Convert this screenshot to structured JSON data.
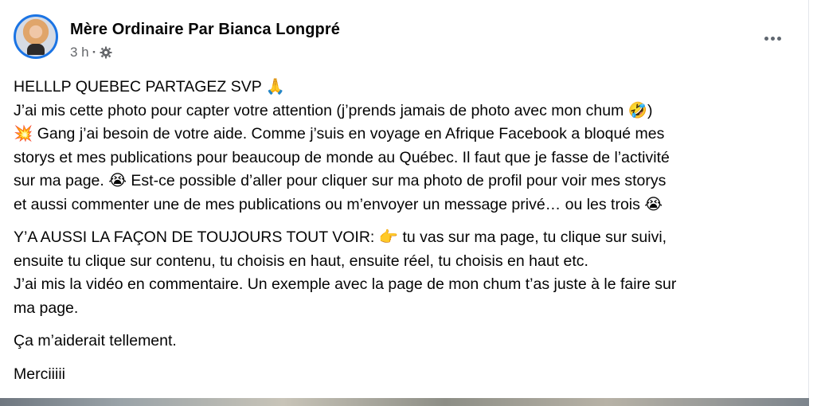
{
  "post": {
    "author": "Mère Ordinaire Par Bianca Longpré",
    "time": "3 h",
    "separator": "·",
    "icons": {
      "privacy": "gear-icon",
      "more": "more-options-icon"
    },
    "paragraphs": [
      {
        "lines": [
          "HELLLP QUEBEC PARTAGEZ SVP 🙏",
          "J’ai mis cette photo pour capter votre attention (j’prends jamais de photo avec mon chum 🤣)",
          "💥 Gang j’ai besoin de votre aide. Comme j’suis en voyage en Afrique Facebook a bloqué mes",
          "storys et mes publications pour beaucoup de monde au Québec. Il faut que je fasse de l’activité",
          "sur ma page. 😭 Est-ce possible d’aller pour cliquer sur ma photo de profil pour voir mes storys",
          "et aussi commenter une de mes publications ou m’envoyer un message privé… ou les trois 😭"
        ]
      },
      {
        "lines": [
          "Y’A AUSSI LA FAÇON DE TOUJOURS TOUT VOIR: 👉 tu vas sur ma page, tu clique sur suivi,",
          "ensuite tu clique sur contenu, tu choisis en haut, ensuite réel, tu choisis en haut etc.",
          "J’ai mis la vidéo en commentaire. Un exemple avec la page de mon chum t’as juste à le faire sur",
          "ma page."
        ]
      },
      {
        "lines": [
          "Ça m’aiderait tellement."
        ]
      },
      {
        "lines": [
          "Merciiiii"
        ]
      }
    ]
  }
}
